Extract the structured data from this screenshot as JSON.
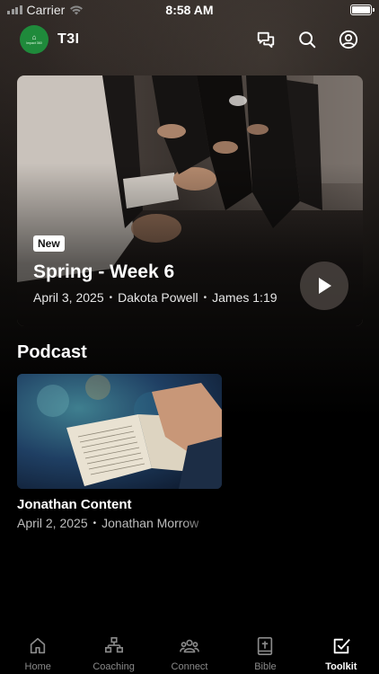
{
  "status_bar": {
    "carrier": "Carrier",
    "time": "8:58 AM",
    "battery_level": 1.0
  },
  "app": {
    "title": "T3I",
    "logo_text": "Impact 360"
  },
  "header_icons": [
    "chat-bubbles-icon",
    "search-icon",
    "profile-icon"
  ],
  "hero": {
    "badge": "New",
    "title": "Spring - Week 6",
    "date": "April 3, 2025",
    "speaker": "Dakota Powell",
    "scripture": "James 1:19",
    "separator": "•"
  },
  "podcast": {
    "section_title": "Podcast",
    "item": {
      "title": "Jonathan Content",
      "date": "April 2, 2025",
      "author": "Jonathan Morrow",
      "separator": "•"
    }
  },
  "tabs": [
    {
      "label": "Home",
      "icon": "home-icon",
      "active": false
    },
    {
      "label": "Coaching",
      "icon": "coaching-icon",
      "active": false
    },
    {
      "label": "Connect",
      "icon": "connect-icon",
      "active": false
    },
    {
      "label": "Bible",
      "icon": "bible-icon",
      "active": false
    },
    {
      "label": "Toolkit",
      "icon": "toolkit-icon",
      "active": true
    }
  ],
  "colors": {
    "background": "#000000",
    "logo_green": "#1f8a3b",
    "inactive_tab": "#8a8a8a",
    "active_tab": "#ffffff"
  }
}
